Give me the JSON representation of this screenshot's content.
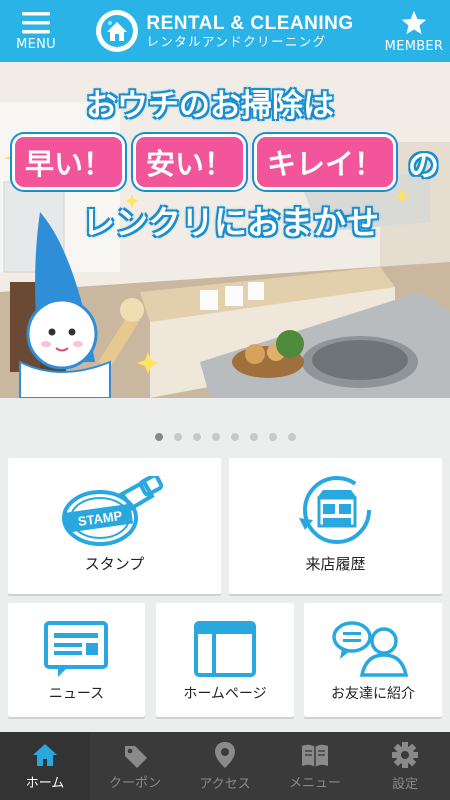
{
  "header": {
    "menu_label": "MENU",
    "logo_en": "RENTAL & CLEANING",
    "logo_jp": "レンタルアンドクリーニング",
    "member_label": "MEMBER"
  },
  "hero": {
    "line1": "おウチのお掃除は",
    "pill1": "早い！",
    "pill2": "安い！",
    "pill3": "キレイ！",
    "no": "の",
    "line3": "レンクリにおまかせ"
  },
  "carousel": {
    "dot_count": 8,
    "active_index": 0
  },
  "menu": {
    "stamp": "スタンプ",
    "history": "来店履歴",
    "news": "ニュース",
    "homepage": "ホームページ",
    "invite": "お友達に紹介"
  },
  "stamp_icon_text": "STAMP",
  "tabs": [
    {
      "label": "ホーム",
      "icon": "home-icon",
      "active": true
    },
    {
      "label": "クーポン",
      "icon": "coupon-tag-icon",
      "active": false
    },
    {
      "label": "アクセス",
      "icon": "map-pin-icon",
      "active": false
    },
    {
      "label": "メニュー",
      "icon": "book-icon",
      "active": false
    },
    {
      "label": "設定",
      "icon": "gear-icon",
      "active": false
    }
  ],
  "colors": {
    "primary": "#2ab3e6",
    "pink": "#f2559a",
    "icon_blue": "#29a8e0",
    "tabbar": "#3a3a3a"
  }
}
